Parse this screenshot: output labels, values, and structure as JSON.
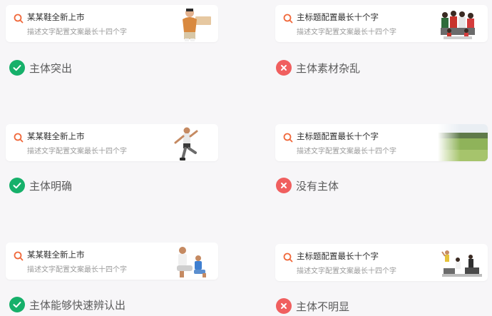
{
  "colors": {
    "good": "#16b06a",
    "bad": "#f05f5f",
    "search_accent": "#f0683a"
  },
  "examples": [
    {
      "title": "某某鞋全新上市",
      "desc": "描述文字配置文案最长十四个字",
      "verdict": "主体突出",
      "type": "good",
      "thumb": "person-holding-shoebox"
    },
    {
      "title": "主标题配置最长十个字",
      "desc": "描述文字配置文案最长十四个字",
      "verdict": "主体素材杂乱",
      "type": "bad",
      "thumb": "group-of-people"
    },
    {
      "title": "某某鞋全新上市",
      "desc": "描述文字配置文案最长十四个字",
      "verdict": "主体明确",
      "type": "good",
      "thumb": "athlete-kicking"
    },
    {
      "title": "主标题配置最长十个字",
      "desc": "描述文字配置文案最长十四个字",
      "verdict": "没有主体",
      "type": "bad",
      "thumb": "grass-field-landscape"
    },
    {
      "title": "某某鞋全新上市",
      "desc": "描述文字配置文案最长十四个字",
      "verdict": "主体能够快速辨认出",
      "type": "good",
      "thumb": "two-people-sitting"
    },
    {
      "title": "主标题配置最长十个字",
      "desc": "描述文字配置文案最长十四个字",
      "verdict": "主体不明显",
      "type": "bad",
      "thumb": "small-distant-figures"
    }
  ]
}
